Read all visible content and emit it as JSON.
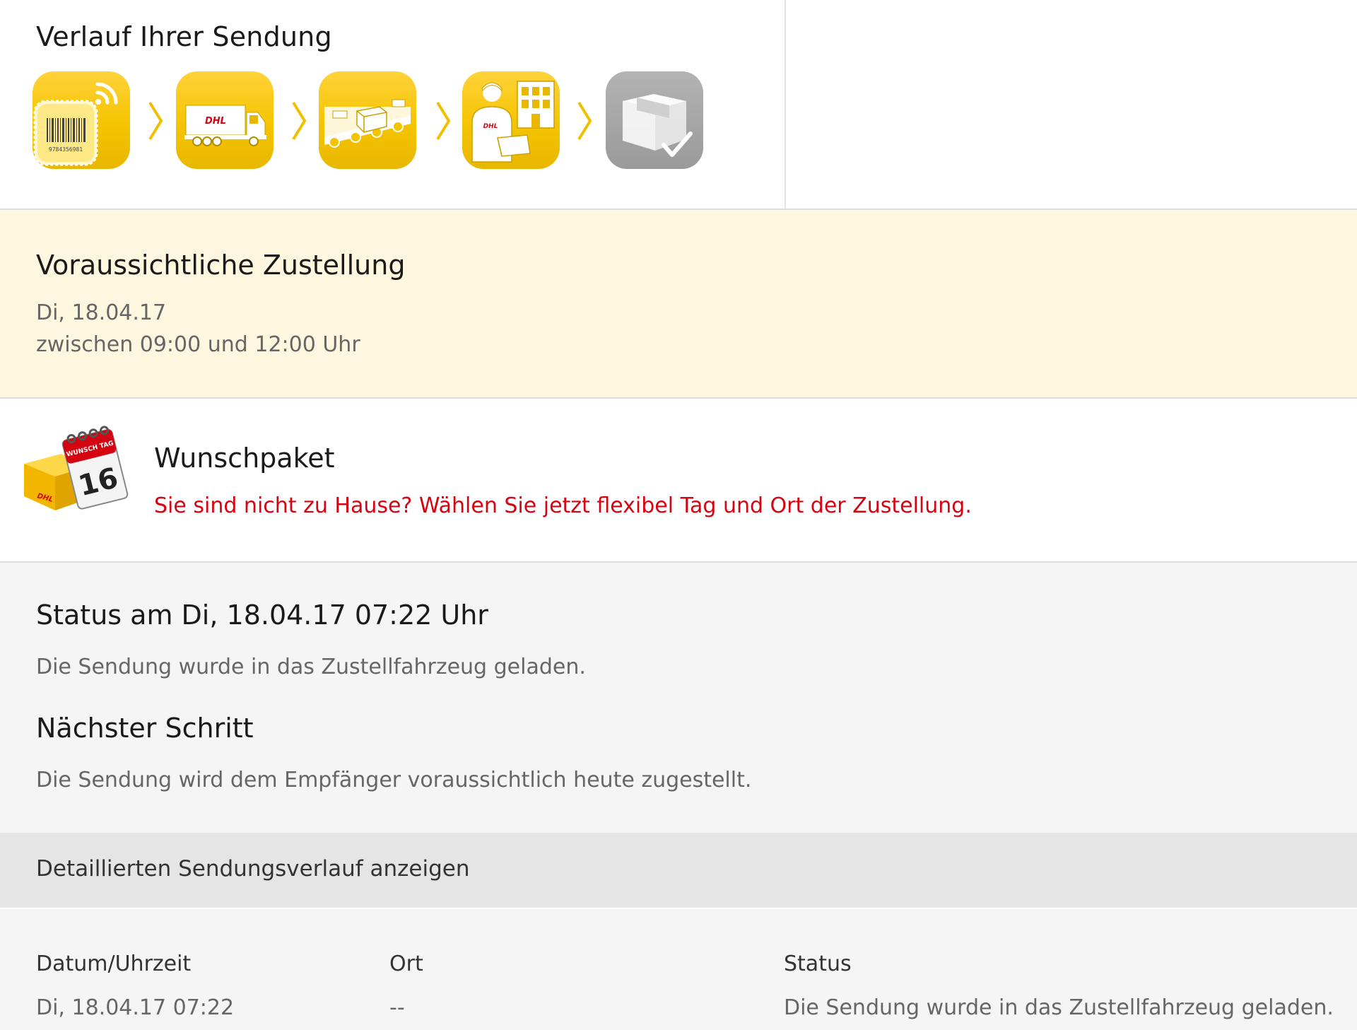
{
  "colors": {
    "dhl_yellow": "#FFCC00",
    "dhl_red": "#D40511",
    "pending_gray": "#A0A0A0",
    "delivery_bg": "#FDF7E0",
    "status_bg": "#F5F5F5"
  },
  "progress": {
    "title": "Verlauf Ihrer Sendung",
    "steps": [
      {
        "icon": "parcel-barcode-icon",
        "state": "done",
        "barcode_number": "9784356981"
      },
      {
        "icon": "truck-icon",
        "state": "done",
        "logo_text": "DHL"
      },
      {
        "icon": "conveyor-belt-icon",
        "state": "done"
      },
      {
        "icon": "courier-icon",
        "state": "done",
        "logo_text": "DHL"
      },
      {
        "icon": "delivered-box-icon",
        "state": "pending"
      }
    ],
    "separator_icon": "chevron-right-icon"
  },
  "delivery": {
    "title": "Voraussichtliche Zustellung",
    "date": "Di, 18.04.17",
    "window": "zwischen 09:00 und 12:00 Uhr"
  },
  "wunschpaket": {
    "icon": "wunschpaket-calendar-icon",
    "icon_label": "WUNSCH TAG",
    "icon_day": "16",
    "icon_logo": "DHL",
    "title": "Wunschpaket",
    "link": "Sie sind nicht zu Hause? Wählen Sie jetzt flexibel Tag und Ort der Zustellung."
  },
  "status": {
    "title": "Status am Di, 18.04.17 07:22 Uhr",
    "text": "Die Sendung wurde in das Zustellfahrzeug geladen.",
    "next_title": "Nächster Schritt",
    "next_text": "Die Sendung wird dem Empfänger voraussichtlich heute zugestellt."
  },
  "detail_toggle": {
    "label": "Detaillierten Sendungsverlauf anzeigen"
  },
  "history": {
    "columns": [
      "Datum/Uhrzeit",
      "Ort",
      "Status"
    ],
    "rows": [
      {
        "date": "Di, 18.04.17 07:22",
        "ort": "--",
        "status": "Die Sendung wurde in das Zustellfahrzeug geladen."
      }
    ]
  }
}
